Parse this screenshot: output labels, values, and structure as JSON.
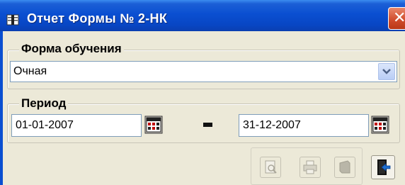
{
  "window": {
    "title": "Отчет Формы № 2-НК",
    "icon": "report-book-icon",
    "close_icon": "close-icon"
  },
  "study_form": {
    "group_label": "Форма обучения",
    "selected_value": "Очная",
    "dropdown_icon": "chevron-down-icon"
  },
  "period": {
    "group_label": "Период",
    "date_from": "01-01-2007",
    "separator": "-",
    "date_to": "31-12-2007",
    "calendar_icon": "calendar-icon"
  },
  "toolbar": {
    "buttons": [
      {
        "icon": "preview-icon",
        "enabled": false
      },
      {
        "icon": "print-icon",
        "enabled": false
      },
      {
        "icon": "export-icon",
        "enabled": false
      },
      {
        "icon": "exit-icon",
        "enabled": true
      }
    ]
  },
  "colors": {
    "titlebar": "#0a4fd1",
    "window_bg": "#ece9d8",
    "close_button": "#cf4a2a",
    "input_border": "#7f9db9"
  }
}
